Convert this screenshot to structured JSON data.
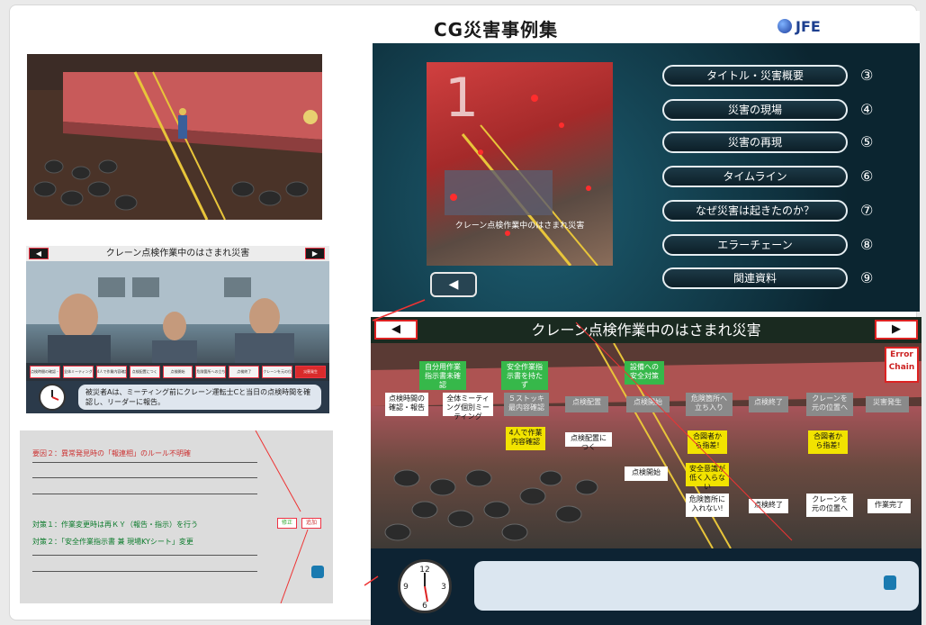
{
  "panel_b": {
    "title": "クレーン点検作業中のはさまれ災害",
    "prev": "◀",
    "next": "▶",
    "strip": [
      "点検時間の確認・報告",
      "全体ミーティング",
      "4人で作業内容確認",
      "点検配置につく",
      "点検開始",
      "危険箇所への立ち入り",
      "点検終了",
      "クレーンを元の位置へ",
      "災害発生"
    ],
    "caption": "被災者Aは、ミーティング前にクレーン運転士Cと当日の点検時間を確認し、リーダーに報告。"
  },
  "panel_c": {
    "cause2": "要因２：異常発見時の「報連相」のルール不明確",
    "measure1": "対策１：作業変更時は再ＫＹ（報告・指示）を行う",
    "measure2": "対策２：「安全作業指示書 兼 現場KYシート」変更",
    "btn_a": "修正",
    "btn_b": "追加"
  },
  "panel_d": {
    "title": "CG災害事例集",
    "logo": "JFE",
    "thumb_caption": "クレーン点検作業中のはさまれ災害",
    "back": "◀",
    "menu": [
      {
        "label": "タイトル・災害概要",
        "num": "③"
      },
      {
        "label": "災害の現場",
        "num": "④"
      },
      {
        "label": "災害の再現",
        "num": "⑤"
      },
      {
        "label": "タイムライン",
        "num": "⑥"
      },
      {
        "label": "なぜ災害は起きたのか？",
        "num": "⑦"
      },
      {
        "label": "エラーチェーン",
        "num": "⑧"
      },
      {
        "label": "関連資料",
        "num": "⑨"
      }
    ]
  },
  "panel_e": {
    "title": "クレーン点検作業中のはさまれ災害",
    "prev": "◀",
    "next": "▶",
    "error_chain": "Error Chain",
    "green_nodes": [
      "自分用作業指示書未確認",
      "安全作業指示書を持たず",
      "設備への安全対策"
    ],
    "row1": [
      "点検時間の確認・報告",
      "全体ミーティング個別ミーティング",
      "５ストッキ最内容確認",
      "点検配置",
      "点検開始",
      "危険箇所へ立ち入り",
      "点検終了",
      "クレーンを元の位置へ",
      "災害発生"
    ],
    "row2": [
      "4人で作業内容確認",
      "点検配置につく",
      "点検開始",
      "合図者から指差!",
      "安全意識が低く入らない",
      "危険箇所に入れない!",
      "点検終了",
      "クレーンを元の位置へ",
      "合図者から指差!",
      "作業完了"
    ]
  },
  "colors": {
    "accent_red": "#d22222",
    "green": "#36b84a",
    "yellow": "#f2e300"
  }
}
